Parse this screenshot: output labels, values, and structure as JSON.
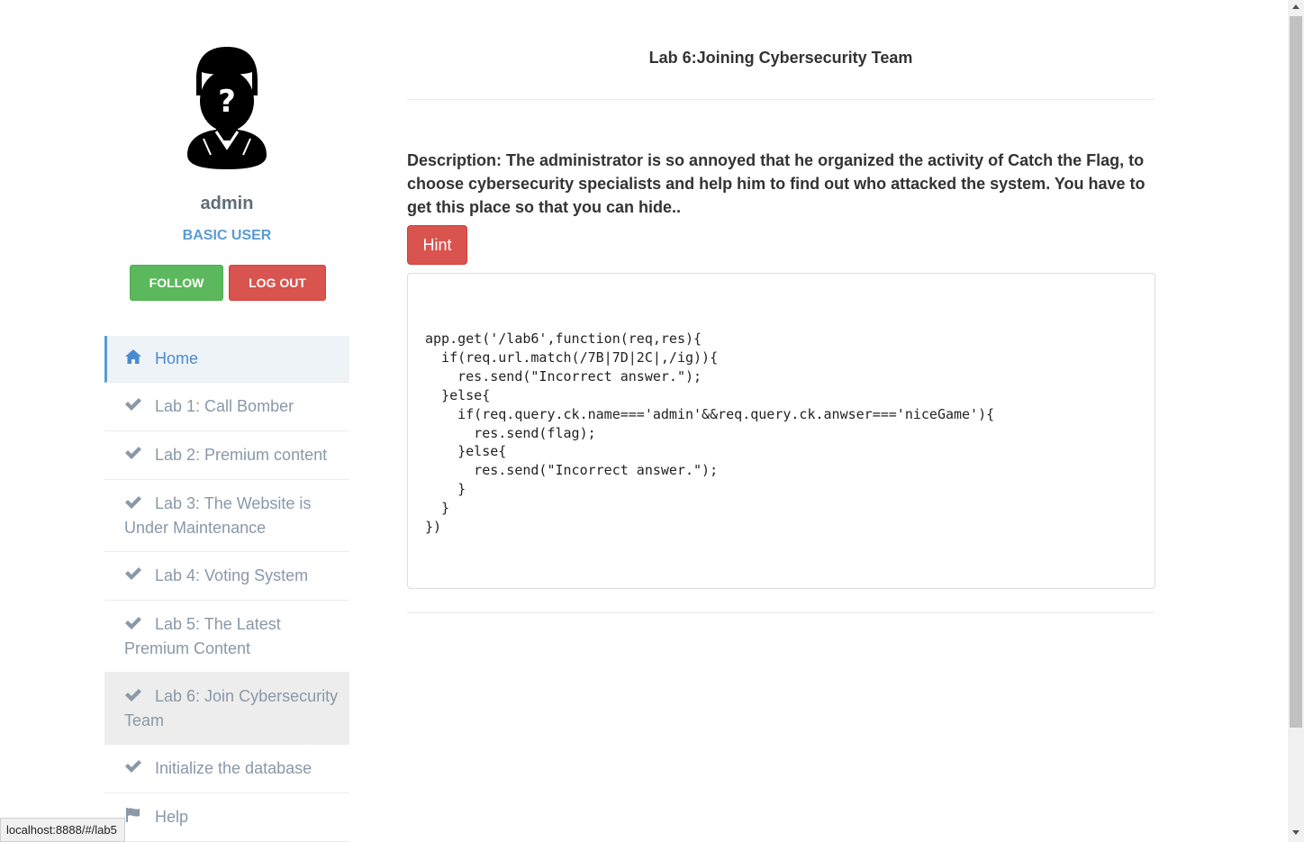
{
  "profile": {
    "avatar_icon": "unknown-user-icon",
    "username": "admin",
    "role": "BASIC USER",
    "follow_label": "FOLLOW",
    "logout_label": "LOG OUT"
  },
  "nav": {
    "home": {
      "icon": "home-icon",
      "label": "Home"
    },
    "items": [
      {
        "icon": "check-icon",
        "label": "Lab 1: Call Bomber"
      },
      {
        "icon": "check-icon",
        "label": "Lab 2: Premium content"
      },
      {
        "icon": "check-icon",
        "label": "Lab 3: The Website is Under Maintenance"
      },
      {
        "icon": "check-icon",
        "label": "Lab 4: Voting System"
      },
      {
        "icon": "check-icon",
        "label": "Lab 5: The Latest Premium Content"
      },
      {
        "icon": "check-icon",
        "label": "Lab 6: Join Cybersecurity Team"
      },
      {
        "icon": "check-icon",
        "label": "Initialize the database"
      },
      {
        "icon": "flag-icon",
        "label": "Help"
      }
    ]
  },
  "main": {
    "title": "Lab 6:Joining Cybersecurity Team",
    "description": "Description: The administrator is so annoyed that he organized the activity of Catch the Flag, to choose cybersecurity specialists and help him to find out who attacked the system. You have to get this place so that you can hide..",
    "hint_label": "Hint",
    "code": "app.get('/lab6',function(req,res){\n  if(req.url.match(/7B|7D|2C|,/ig)){\n    res.send(\"Incorrect answer.\");\n  }else{\n    if(req.query.ck.name==='admin'&&req.query.ck.anwser==='niceGame'){\n      res.send(flag);\n    }else{\n      res.send(\"Incorrect answer.\");\n    }\n  }\n})"
  },
  "statusbar": {
    "url": "localhost:8888/#/lab5"
  },
  "colors": {
    "accent": "#5a9bd5",
    "follow": "#5cb85c",
    "danger": "#d9534f",
    "nav_text": "#8a98a8"
  }
}
